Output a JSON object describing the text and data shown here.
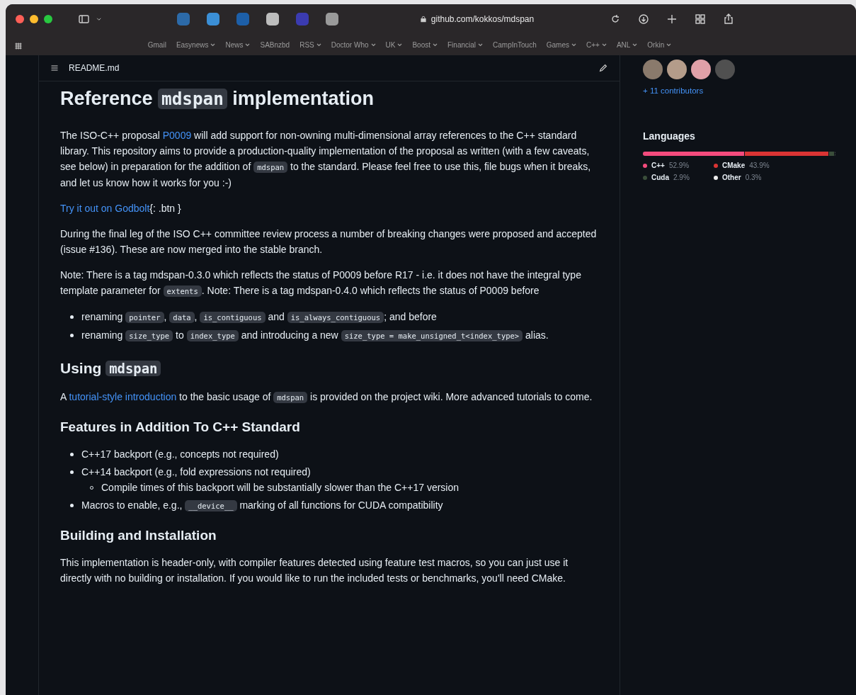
{
  "browser": {
    "address": "github.com/kokkos/mdspan",
    "bookmarks": [
      {
        "label": "Gmail",
        "dropdown": false
      },
      {
        "label": "Easynews",
        "dropdown": true
      },
      {
        "label": "News",
        "dropdown": true
      },
      {
        "label": "SABnzbd",
        "dropdown": false
      },
      {
        "label": "RSS",
        "dropdown": true
      },
      {
        "label": "Doctor Who",
        "dropdown": true
      },
      {
        "label": "UK",
        "dropdown": true
      },
      {
        "label": "Boost",
        "dropdown": true
      },
      {
        "label": "Financial",
        "dropdown": true
      },
      {
        "label": "CampInTouch",
        "dropdown": false
      },
      {
        "label": "Games",
        "dropdown": true
      },
      {
        "label": "C++",
        "dropdown": true
      },
      {
        "label": "ANL",
        "dropdown": true
      },
      {
        "label": "Orkin",
        "dropdown": true
      }
    ]
  },
  "readme": {
    "filename": "README.md",
    "blocks": [
      {
        "kind": "h1",
        "parts": [
          {
            "kind": "text",
            "text": "Reference "
          },
          {
            "kind": "code",
            "text": "mdspan"
          },
          {
            "kind": "text",
            "text": " implementation"
          }
        ]
      },
      {
        "kind": "p",
        "parts": [
          {
            "kind": "text",
            "text": "The ISO-C++ proposal "
          },
          {
            "kind": "link",
            "text": "P0009"
          },
          {
            "kind": "text",
            "text": " will add support for non-owning multi-dimensional array references to the C++ standard library. This repository aims to provide a production-quality implementation of the proposal as written (with a few caveats, see below) in preparation for the addition of "
          },
          {
            "kind": "code",
            "text": "mdspan"
          },
          {
            "kind": "text",
            "text": " to the standard. Please feel free to use this, file bugs when it breaks, and let us know how it works for you :-)"
          }
        ]
      },
      {
        "kind": "p",
        "parts": [
          {
            "kind": "link",
            "text": "Try it out on Godbolt"
          },
          {
            "kind": "text",
            "text": "{: .btn }"
          }
        ]
      },
      {
        "kind": "p",
        "parts": [
          {
            "kind": "text",
            "text": "During the final leg of the ISO C++ committee review process a number of breaking changes were proposed and accepted (issue #136). These are now merged into the stable branch."
          }
        ]
      },
      {
        "kind": "p",
        "parts": [
          {
            "kind": "text",
            "text": "Note: There is a tag mdspan-0.3.0 which reflects the status of P0009 before R17 - i.e. it does not have the integral type template parameter for "
          },
          {
            "kind": "code",
            "text": "extents"
          },
          {
            "kind": "text",
            "text": ". Note: There is a tag mdspan-0.4.0 which reflects the status of P0009 before"
          }
        ]
      },
      {
        "kind": "ul",
        "items": [
          {
            "parts": [
              {
                "kind": "text",
                "text": "renaming "
              },
              {
                "kind": "code",
                "text": "pointer"
              },
              {
                "kind": "text",
                "text": ", "
              },
              {
                "kind": "code",
                "text": "data"
              },
              {
                "kind": "text",
                "text": ", "
              },
              {
                "kind": "code",
                "text": "is_contiguous"
              },
              {
                "kind": "text",
                "text": " and "
              },
              {
                "kind": "code",
                "text": "is_always_contiguous"
              },
              {
                "kind": "text",
                "text": "; and before"
              }
            ]
          },
          {
            "parts": [
              {
                "kind": "text",
                "text": "renaming "
              },
              {
                "kind": "code",
                "text": "size_type"
              },
              {
                "kind": "text",
                "text": " to "
              },
              {
                "kind": "code",
                "text": "index_type"
              },
              {
                "kind": "text",
                "text": " and introducing a new "
              },
              {
                "kind": "code",
                "text": "size_type = make_unsigned_t<index_type>"
              },
              {
                "kind": "text",
                "text": " alias."
              }
            ]
          }
        ]
      },
      {
        "kind": "h2",
        "parts": [
          {
            "kind": "text",
            "text": "Using "
          },
          {
            "kind": "code",
            "text": "mdspan"
          }
        ]
      },
      {
        "kind": "p",
        "parts": [
          {
            "kind": "text",
            "text": "A "
          },
          {
            "kind": "link",
            "text": "tutorial-style introduction"
          },
          {
            "kind": "text",
            "text": " to the basic usage of "
          },
          {
            "kind": "code",
            "text": "mdspan"
          },
          {
            "kind": "text",
            "text": " is provided on the project wiki. More advanced tutorials to come."
          }
        ]
      },
      {
        "kind": "h3",
        "parts": [
          {
            "kind": "text",
            "text": "Features in Addition To C++ Standard"
          }
        ]
      },
      {
        "kind": "ul",
        "items": [
          {
            "parts": [
              {
                "kind": "text",
                "text": "C++17 backport (e.g., concepts not required)"
              }
            ]
          },
          {
            "parts": [
              {
                "kind": "text",
                "text": "C++14 backport (e.g., fold expressions not required)"
              }
            ],
            "children": [
              {
                "parts": [
                  {
                    "kind": "text",
                    "text": "Compile times of this backport will be substantially slower than the C++17 version"
                  }
                ]
              }
            ]
          },
          {
            "parts": [
              {
                "kind": "text",
                "text": "Macros to enable, e.g., "
              },
              {
                "kind": "code",
                "text": "__device__"
              },
              {
                "kind": "text",
                "text": " marking of all functions for CUDA compatibility"
              }
            ]
          }
        ]
      },
      {
        "kind": "h3",
        "parts": [
          {
            "kind": "text",
            "text": "Building and Installation"
          }
        ]
      },
      {
        "kind": "p",
        "parts": [
          {
            "kind": "text",
            "text": "This implementation is header-only, with compiler features detected using feature test macros, so you can just use it directly with no building or installation. If you would like to run the included tests or benchmarks, you'll need CMake."
          }
        ]
      }
    ]
  },
  "sidebar": {
    "contributors_link": "+ 11 contributors",
    "languages_title": "Languages",
    "languages": [
      {
        "name": "C++",
        "percent": "52.9%",
        "color": "#f34b7d"
      },
      {
        "name": "CMake",
        "percent": "43.9%",
        "color": "#da3434"
      },
      {
        "name": "Cuda",
        "percent": "2.9%",
        "color": "#3a4e3a"
      },
      {
        "name": "Other",
        "percent": "0.3%",
        "color": "#ededed"
      }
    ]
  }
}
